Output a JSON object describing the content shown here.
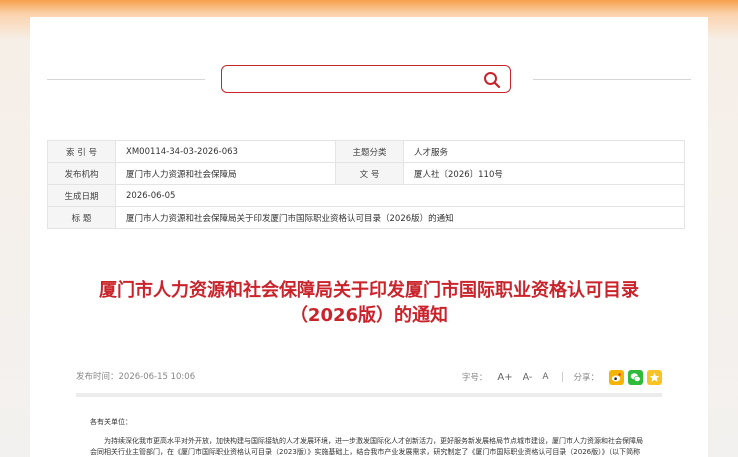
{
  "search": {
    "placeholder": "",
    "value": ""
  },
  "info": {
    "index_label": "索 引 号",
    "index_value": "XM00114-34-03-2026-063",
    "topic_label": "主题分类",
    "topic_value": "人才服务",
    "org_label": "发布机构",
    "org_value": "厦门市人力资源和社会保障局",
    "docno_label": "文 号",
    "docno_value": "厦人社〔2026〕110号",
    "date_label": "生成日期",
    "date_value": "2026-06-05",
    "title_label": "标 题",
    "title_value": "厦门市人力资源和社会保障局关于印发厦门市国际职业资格认可目录（2026版）的通知"
  },
  "article": {
    "title_line1": "厦门市人力资源和社会保障局关于印发厦门市国际职业资格认可目录",
    "title_line2": "（2026版）的通知",
    "publish_time": "发布时间：2026-06-15 10:06",
    "font_size_label": "字号：",
    "font_large": "A+",
    "font_medium": "A-",
    "font_small": "A",
    "share_label": "分享：",
    "salutation": "各有关单位：",
    "paragraph": "为持续深化我市更高水平对外开放，加快构建与国际接轨的人才发展环境，进一步激发国际化人才创新活力，更好服务新发展格局节点城市建设，厦门市人力资源和社会保障局会同相关行业主管部门，在《厦门市国际职业资格认可目录（2023版）》实施基础上，结合我市产业发展需求，研究制定了《厦门市国际职业资格认可目录（2026版）》（以下简称《目录》）。现印发给你们，并就有关事项通知如下："
  },
  "icons": {
    "search": "search-icon",
    "weibo": "weibo-icon",
    "wechat": "wechat-icon",
    "qzone": "qzone-icon"
  },
  "colors": {
    "accent": "#c9242b",
    "banner": "#f7a04c"
  }
}
